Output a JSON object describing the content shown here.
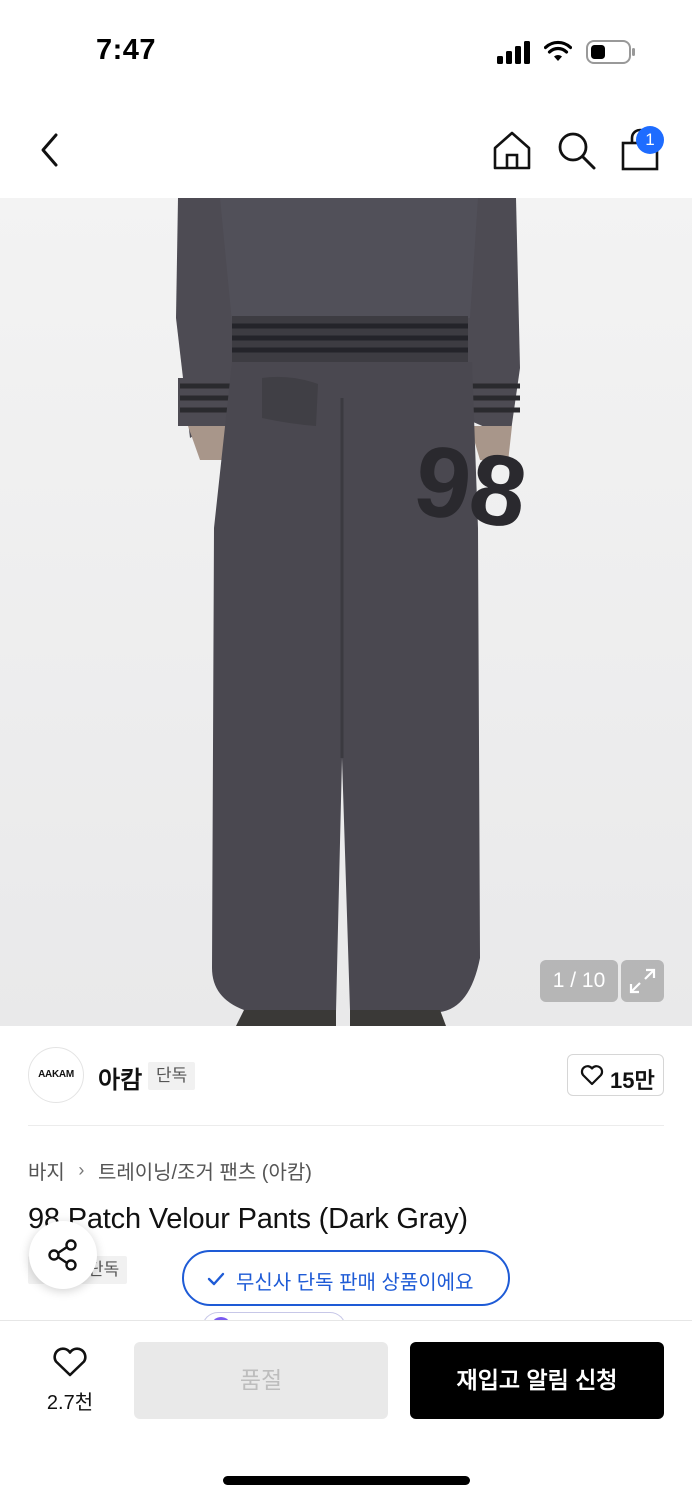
{
  "status_bar": {
    "time": "7:47"
  },
  "header": {
    "cart_badge": "1"
  },
  "gallery": {
    "counter": "1 / 10"
  },
  "brand": {
    "logo_text": "AAKAM",
    "name": "아캄",
    "badge": "단독",
    "likes": "15만"
  },
  "breadcrumb": {
    "category": "바지",
    "subcategory": "트레이닝/조거 팬츠 (아캄)"
  },
  "product": {
    "title": "98 Patch Velour Pants (Dark Gray)",
    "badge": "단독"
  },
  "tooltip": {
    "text": "무신사 단독 판매 상품이에요"
  },
  "bottom_bar": {
    "wishlist_count": "2.7천",
    "soldout_label": "품절",
    "restock_label": "재입고 알림 신청"
  },
  "colors": {
    "accent_blue": "#1e5bd6",
    "badge_blue": "#1e6cff",
    "pants": "#4a4850"
  }
}
